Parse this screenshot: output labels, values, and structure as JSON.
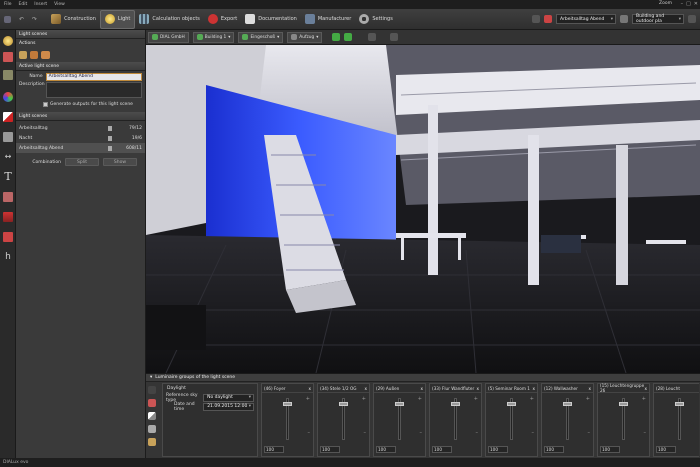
{
  "menu": {
    "file": "File",
    "edit": "Edit",
    "insert": "Insert",
    "view": "View",
    "zoom": "Zoom"
  },
  "toolbar": {
    "construction": "Construction",
    "light": "Light",
    "calculation": "Calculation objects",
    "export": "Export",
    "documentation": "Documentation",
    "manufacturer": "Manufacturer",
    "settings": "Settings",
    "scene_select": "Arbeitsalltag Abend",
    "view_select": "Building and outdoor pla"
  },
  "panel": {
    "light_scenes_header": "Light scenes",
    "actions_header": "Actions",
    "active_header": "Active light scene",
    "name_label": "Name",
    "name_value": "Arbeitsalltag Abend",
    "description_label": "Description",
    "generate_label": "Generate outputs for this light scene",
    "list_header": "Light scenes",
    "scenes": [
      {
        "name": "Arbeitsalltag",
        "value": "79/12"
      },
      {
        "name": "Nacht",
        "value": "19/6"
      },
      {
        "name": "Arbeitsalltag Abend",
        "value": "608/11"
      }
    ],
    "combination_label": "Combination",
    "split_label": "Split",
    "show_label": "Show"
  },
  "viewtoolbar": {
    "dial": "DIAL GmbH",
    "building": "Building 1",
    "floor": "Eingeschoß",
    "room": "Aufzug"
  },
  "bottom": {
    "header": "Luminaire groups of the light scene",
    "daylight": "Daylight",
    "sky_label": "Reference sky type",
    "sky_value": "No daylight",
    "date_label": "Date and time",
    "date_value": "21.09.2015 12:00",
    "groups": [
      {
        "title": "(46) Foyer",
        "value": "100"
      },
      {
        "title": "(34) Stele 1/2 OG",
        "value": "100"
      },
      {
        "title": "(29) Außen",
        "value": "100"
      },
      {
        "title": "(33) Flur Wandfluter",
        "value": "100"
      },
      {
        "title": "(5) Seminar Room 1",
        "value": "100"
      },
      {
        "title": "(12) Wallwasher",
        "value": "100"
      },
      {
        "title": "(15) Leuchtengruppe 26",
        "value": "100"
      },
      {
        "title": "(28) Leucht",
        "value": "100"
      }
    ]
  },
  "status": {
    "text": "DIALux evo"
  }
}
